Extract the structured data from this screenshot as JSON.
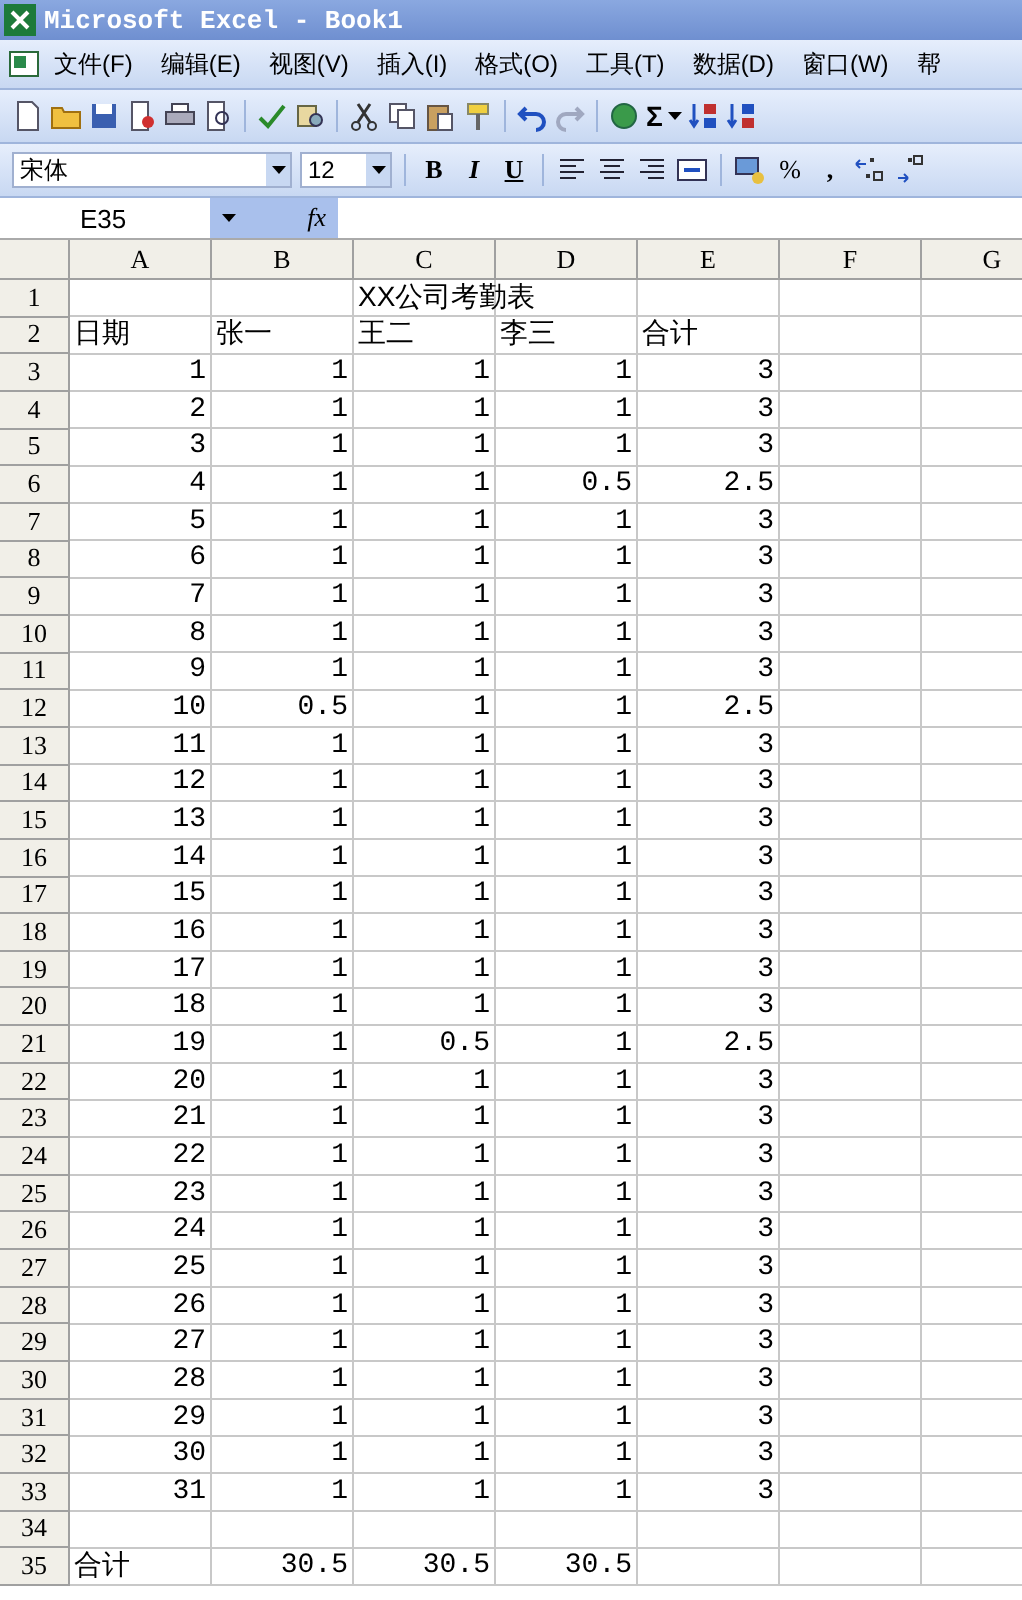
{
  "window": {
    "title": "Microsoft Excel - Book1"
  },
  "menu": [
    "文件(F)",
    "编辑(E)",
    "视图(V)",
    "插入(I)",
    "格式(O)",
    "工具(T)",
    "数据(D)",
    "窗口(W)",
    "帮"
  ],
  "standard_toolbar": {
    "autosum": "Σ"
  },
  "format_toolbar": {
    "font": "宋体",
    "size": "12",
    "bold": "B",
    "italic": "I",
    "underline": "U",
    "percent": "%",
    "comma": ","
  },
  "formula_bar": {
    "name_box": "E35",
    "fx": "fx"
  },
  "columns": [
    "A",
    "B",
    "C",
    "D",
    "E",
    "F",
    "G"
  ],
  "rows": [
    {
      "header": "1",
      "cells": [
        "",
        "",
        "XX公司考勤表",
        "",
        "",
        "",
        ""
      ]
    },
    {
      "header": "2",
      "cells": [
        "日期",
        "张一",
        "王二",
        "李三",
        "合计",
        "",
        ""
      ]
    },
    {
      "header": "3",
      "cells": [
        "1",
        "1",
        "1",
        "1",
        "3",
        "",
        ""
      ]
    },
    {
      "header": "4",
      "cells": [
        "2",
        "1",
        "1",
        "1",
        "3",
        "",
        ""
      ]
    },
    {
      "header": "5",
      "cells": [
        "3",
        "1",
        "1",
        "1",
        "3",
        "",
        ""
      ]
    },
    {
      "header": "6",
      "cells": [
        "4",
        "1",
        "1",
        "0.5",
        "2.5",
        "",
        ""
      ]
    },
    {
      "header": "7",
      "cells": [
        "5",
        "1",
        "1",
        "1",
        "3",
        "",
        ""
      ]
    },
    {
      "header": "8",
      "cells": [
        "6",
        "1",
        "1",
        "1",
        "3",
        "",
        ""
      ]
    },
    {
      "header": "9",
      "cells": [
        "7",
        "1",
        "1",
        "1",
        "3",
        "",
        ""
      ]
    },
    {
      "header": "10",
      "cells": [
        "8",
        "1",
        "1",
        "1",
        "3",
        "",
        ""
      ]
    },
    {
      "header": "11",
      "cells": [
        "9",
        "1",
        "1",
        "1",
        "3",
        "",
        ""
      ]
    },
    {
      "header": "12",
      "cells": [
        "10",
        "0.5",
        "1",
        "1",
        "2.5",
        "",
        ""
      ]
    },
    {
      "header": "13",
      "cells": [
        "11",
        "1",
        "1",
        "1",
        "3",
        "",
        ""
      ]
    },
    {
      "header": "14",
      "cells": [
        "12",
        "1",
        "1",
        "1",
        "3",
        "",
        ""
      ]
    },
    {
      "header": "15",
      "cells": [
        "13",
        "1",
        "1",
        "1",
        "3",
        "",
        ""
      ]
    },
    {
      "header": "16",
      "cells": [
        "14",
        "1",
        "1",
        "1",
        "3",
        "",
        ""
      ]
    },
    {
      "header": "17",
      "cells": [
        "15",
        "1",
        "1",
        "1",
        "3",
        "",
        ""
      ]
    },
    {
      "header": "18",
      "cells": [
        "16",
        "1",
        "1",
        "1",
        "3",
        "",
        ""
      ]
    },
    {
      "header": "19",
      "cells": [
        "17",
        "1",
        "1",
        "1",
        "3",
        "",
        ""
      ]
    },
    {
      "header": "20",
      "cells": [
        "18",
        "1",
        "1",
        "1",
        "3",
        "",
        ""
      ]
    },
    {
      "header": "21",
      "cells": [
        "19",
        "1",
        "0.5",
        "1",
        "2.5",
        "",
        ""
      ]
    },
    {
      "header": "22",
      "cells": [
        "20",
        "1",
        "1",
        "1",
        "3",
        "",
        ""
      ]
    },
    {
      "header": "23",
      "cells": [
        "21",
        "1",
        "1",
        "1",
        "3",
        "",
        ""
      ]
    },
    {
      "header": "24",
      "cells": [
        "22",
        "1",
        "1",
        "1",
        "3",
        "",
        ""
      ]
    },
    {
      "header": "25",
      "cells": [
        "23",
        "1",
        "1",
        "1",
        "3",
        "",
        ""
      ]
    },
    {
      "header": "26",
      "cells": [
        "24",
        "1",
        "1",
        "1",
        "3",
        "",
        ""
      ]
    },
    {
      "header": "27",
      "cells": [
        "25",
        "1",
        "1",
        "1",
        "3",
        "",
        ""
      ]
    },
    {
      "header": "28",
      "cells": [
        "26",
        "1",
        "1",
        "1",
        "3",
        "",
        ""
      ]
    },
    {
      "header": "29",
      "cells": [
        "27",
        "1",
        "1",
        "1",
        "3",
        "",
        ""
      ]
    },
    {
      "header": "30",
      "cells": [
        "28",
        "1",
        "1",
        "1",
        "3",
        "",
        ""
      ]
    },
    {
      "header": "31",
      "cells": [
        "29",
        "1",
        "1",
        "1",
        "3",
        "",
        ""
      ]
    },
    {
      "header": "32",
      "cells": [
        "30",
        "1",
        "1",
        "1",
        "3",
        "",
        ""
      ]
    },
    {
      "header": "33",
      "cells": [
        "31",
        "1",
        "1",
        "1",
        "3",
        "",
        ""
      ]
    },
    {
      "header": "34",
      "cells": [
        "",
        "",
        "",
        "",
        "",
        "",
        ""
      ]
    },
    {
      "header": "35",
      "cells": [
        "合计",
        "30.5",
        "30.5",
        "30.5",
        "",
        "",
        ""
      ]
    }
  ]
}
